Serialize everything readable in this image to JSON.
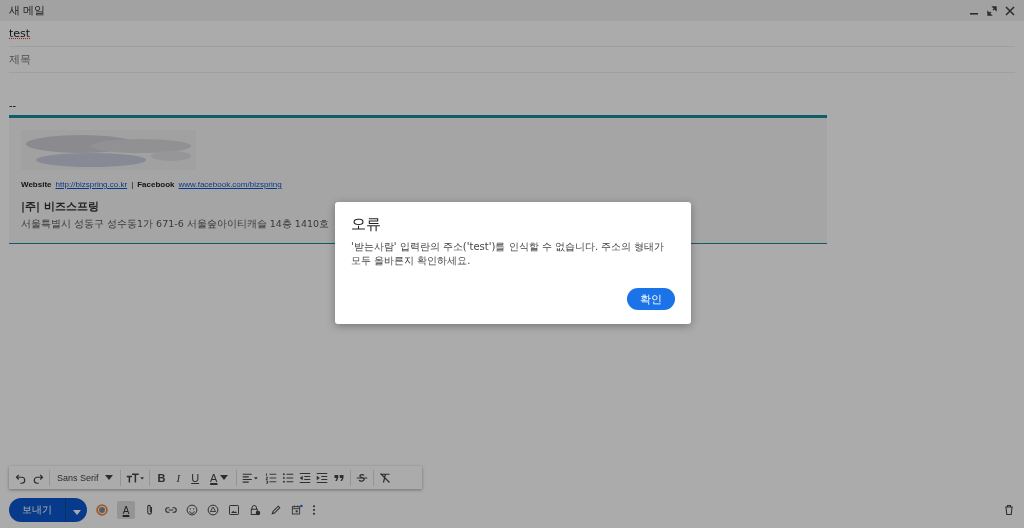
{
  "window": {
    "title": "새 메일"
  },
  "compose": {
    "to": "test",
    "subject_placeholder": "제목",
    "body_separator": "--"
  },
  "signature": {
    "website_label": "Website",
    "website_link": "http://bizspring.co.kr",
    "divider": "|",
    "facebook_label": "Facebook",
    "facebook_link": "www.facebook.com/bizspring",
    "company": "|주| 비즈스프링",
    "address": "서울특별시 성동구 성수동1가 671-6 서울숲아이티캐슬 14층 1410호"
  },
  "format_toolbar": {
    "font": "Sans Serif",
    "bold": "B",
    "italic": "I",
    "underline": "U",
    "text_color": "A"
  },
  "bottom_bar": {
    "send": "보내기",
    "formatting_toggle": {
      "label": "A",
      "selected": true
    },
    "schedule_badge": true
  },
  "dialog": {
    "title": "오류",
    "message": "'받는사람' 입력란의 주소('test')를 인식할 수 없습니다. 주소의 형태가 모두 올바른지 확인하세요.",
    "ok": "확인"
  }
}
